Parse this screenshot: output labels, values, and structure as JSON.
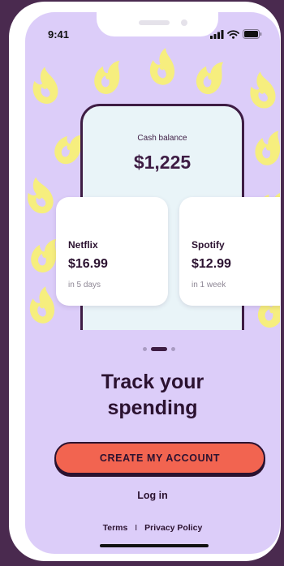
{
  "status_bar": {
    "time": "9:41"
  },
  "hero": {
    "cash_balance_label": "Cash balance",
    "cash_balance_amount": "$1,225",
    "bills": [
      {
        "name": "Netflix",
        "amount": "$16.99",
        "due": "in 5 days"
      },
      {
        "name": "Spotify",
        "amount": "$12.99",
        "due": "in 1 week"
      }
    ]
  },
  "pager": {
    "total": 3,
    "active_index": 1
  },
  "headline": {
    "line1": "Track your",
    "line2": "spending"
  },
  "actions": {
    "create_account_label": "CREATE MY ACCOUNT",
    "login_label": "Log in"
  },
  "footer": {
    "terms_label": "Terms",
    "separator": "I",
    "privacy_label": "Privacy Policy"
  },
  "colors": {
    "background": "#dccdf9",
    "accent": "#f26450",
    "dark": "#2b1230",
    "flame": "#f6ee7e"
  },
  "icons": [
    "signal-icon",
    "wifi-icon",
    "battery-icon",
    "flame-icon"
  ]
}
